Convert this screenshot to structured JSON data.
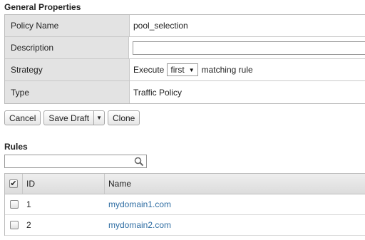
{
  "general": {
    "title": "General Properties",
    "rows": [
      {
        "label": "Policy Name",
        "value": "pool_selection"
      },
      {
        "label": "Description",
        "value": ""
      },
      {
        "label": "Strategy",
        "prefix": "Execute",
        "select_value": "first",
        "suffix": "matching rule"
      },
      {
        "label": "Type",
        "value": "Traffic Policy"
      }
    ]
  },
  "buttons": {
    "cancel": "Cancel",
    "save_draft": "Save Draft",
    "clone": "Clone"
  },
  "rules": {
    "title": "Rules",
    "search_placeholder": "",
    "columns": {
      "id": "ID",
      "name": "Name"
    },
    "header_checked": true,
    "rows": [
      {
        "id": "1",
        "name": "mydomain1.com",
        "checked": false
      },
      {
        "id": "2",
        "name": "mydomain2.com",
        "checked": false
      }
    ]
  },
  "icons": {
    "search": "search-icon",
    "dropdown": "chevron-down-icon",
    "check": "checkmark-icon"
  },
  "colors": {
    "link": "#2d6ca2",
    "label_bg": "#e3e3e3"
  }
}
